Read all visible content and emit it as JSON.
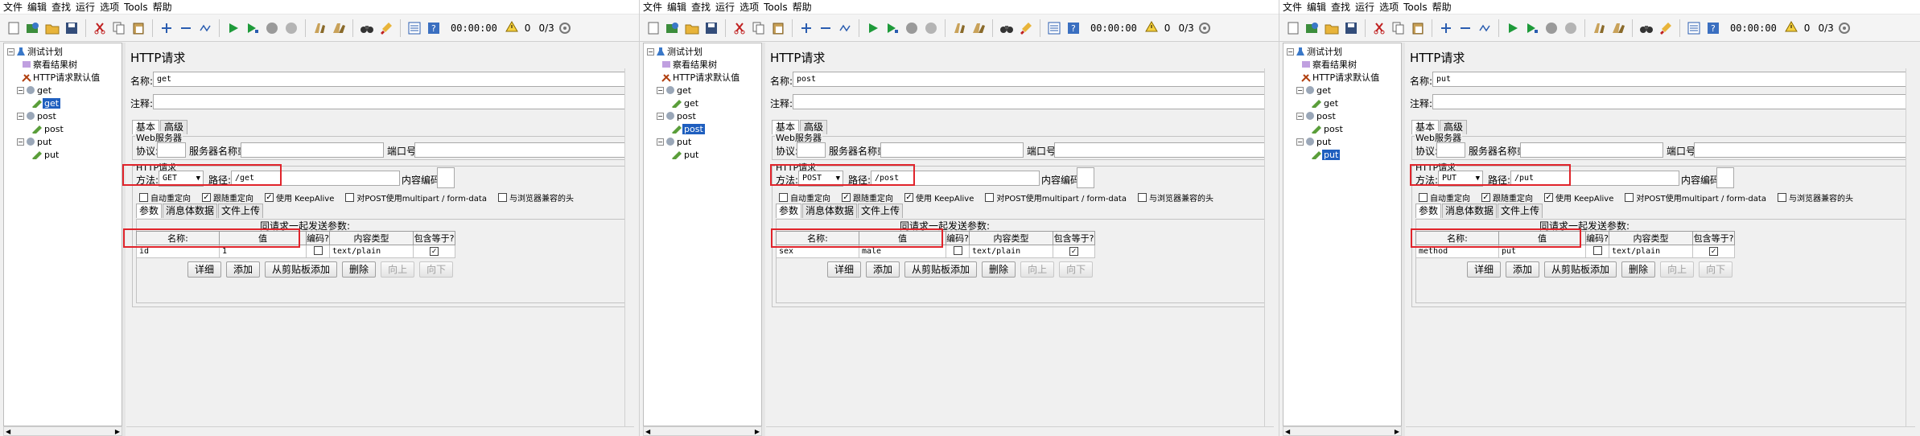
{
  "menu": [
    "文件",
    "编辑",
    "查找",
    "运行",
    "选项",
    "Tools",
    "帮助"
  ],
  "toolbar": {
    "timer": "00:00:00",
    "warn_count": "0",
    "ratio": "0/3"
  },
  "tree": {
    "plan": "测试计划",
    "view_results": "察看结果树",
    "http_defaults": "HTTP请求默认值",
    "get_group": "get",
    "get_sampler": "get",
    "post_group": "post",
    "post_sampler": "post",
    "put_group": "put",
    "put_sampler": "put",
    "scroll_left": "◀",
    "scroll_right": "▶"
  },
  "editor": {
    "title": "HTTP请求",
    "name_label": "名称:",
    "comment_label": "注释:",
    "tab_basic": "基本",
    "tab_advanced": "高级",
    "web_server": "Web服务器",
    "protocol_label": "协议:",
    "server_label": "服务器名称或IP:",
    "port_label": "端口号:",
    "http_request_group": "HTTP请求",
    "method_label": "方法:",
    "path_label": "路径:",
    "encoding_label": "内容编码:",
    "checkboxes": [
      "自动重定向",
      "跟随重定向",
      "使用 KeepAlive",
      "对POST使用multipart / form-data",
      "与浏览器兼容的头"
    ],
    "sub_tab_params": "参数",
    "sub_tab_body": "消息体数据",
    "sub_tab_files": "文件上传",
    "params_title": "同请求一起发送参数:",
    "columns": [
      "名称:",
      "值",
      "编码?",
      "内容类型",
      "包含等于?"
    ],
    "buttons": [
      "详细",
      "添加",
      "从剪贴板添加",
      "删除",
      "向上",
      "向下"
    ]
  },
  "screens": [
    {
      "name": "get",
      "method": "GET",
      "path": "/get",
      "selected": "get_sampler",
      "row": {
        "name": "id",
        "value": "1",
        "content_type": "text/plain"
      }
    },
    {
      "name": "post",
      "method": "POST",
      "path": "/post",
      "selected": "post_sampler",
      "row": {
        "name": "sex",
        "value": "male",
        "content_type": "text/plain"
      }
    },
    {
      "name": "put",
      "method": "PUT",
      "path": "/put",
      "selected": "put_sampler",
      "row": {
        "name": "method",
        "value": "put",
        "content_type": "text/plain"
      }
    }
  ],
  "colors": {
    "highlight": "#e0242b",
    "selection": "#1f5fbf"
  }
}
